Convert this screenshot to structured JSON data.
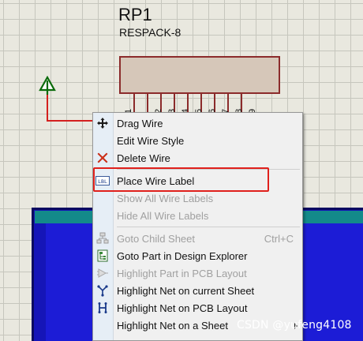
{
  "component": {
    "reference": "RP1",
    "value": "RESPACK-8",
    "pins": [
      "1",
      "2",
      "3",
      "4",
      "5",
      "6",
      "7",
      "8",
      "9"
    ]
  },
  "colors": {
    "wire": "#d4201e",
    "terminal": "#0b6b0b",
    "component_outline": "#8b2b2b",
    "component_fill": "#d6c7b9",
    "highlight": "#e0201c"
  },
  "context_menu": {
    "items": [
      {
        "label": "Drag Wire",
        "icon": "move-icon",
        "enabled": true
      },
      {
        "label": "Edit Wire Style",
        "icon": "",
        "enabled": true
      },
      {
        "label": "Delete Wire",
        "icon": "delete-x-icon",
        "enabled": true
      },
      {
        "label": "Place Wire Label",
        "icon": "wire-label-icon",
        "enabled": true,
        "highlighted": true
      },
      {
        "label": "Show All Wire Labels",
        "icon": "",
        "enabled": false
      },
      {
        "label": "Hide All Wire Labels",
        "icon": "",
        "enabled": false
      },
      {
        "label": "Goto Child Sheet",
        "icon": "child-sheet-icon",
        "enabled": false,
        "shortcut": "Ctrl+C"
      },
      {
        "label": "Goto Part in Design Explorer",
        "icon": "design-explorer-icon",
        "enabled": true
      },
      {
        "label": "Highlight Part in PCB Layout",
        "icon": "pcb-part-icon",
        "enabled": false
      },
      {
        "label": "Highlight Net on current Sheet",
        "icon": "net-sheet-icon",
        "enabled": true
      },
      {
        "label": "Highlight Net on PCB Layout",
        "icon": "net-pcb-icon",
        "enabled": true
      },
      {
        "label": "Highlight Net on a Sheet",
        "icon": "",
        "enabled": true,
        "submenu": true
      }
    ]
  },
  "watermark": "CSDN @yufeng4108"
}
